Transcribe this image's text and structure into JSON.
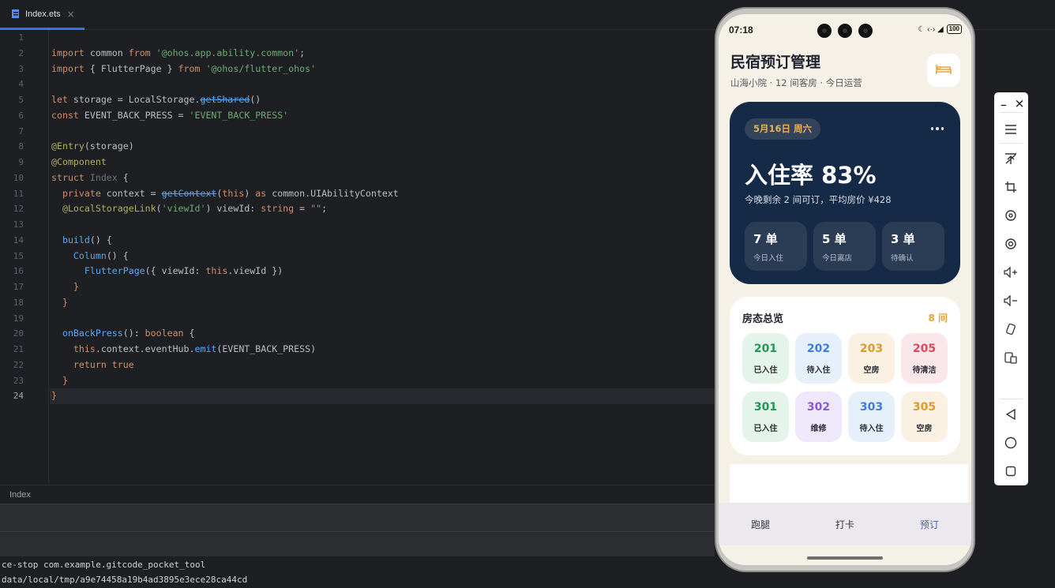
{
  "editor": {
    "tab_label": "Index.ets",
    "tab_close": "×",
    "line_numbers": [
      "1",
      "2",
      "3",
      "4",
      "5",
      "6",
      "7",
      "8",
      "9",
      "10",
      "11",
      "12",
      "13",
      "14",
      "15",
      "16",
      "17",
      "18",
      "19",
      "20",
      "21",
      "22",
      "23",
      "24"
    ],
    "code": {
      "l2_kw1": "import",
      "l2_mid": " common ",
      "l2_kw2": "from",
      "l2_str": " '@ohos.app.ability.common'",
      "l2_end": ";",
      "l3_kw1": "import",
      "l3_mid": " { FlutterPage } ",
      "l3_kw2": "from",
      "l3_str": " '@ohos/flutter_ohos'",
      "l5_kw": "let",
      "l5_mid": " storage = LocalStorage.",
      "l5_fn": "getShared",
      "l5_end": "()",
      "l6_kw": "const",
      "l6_mid": " EVENT_BACK_PRESS = ",
      "l6_str": "'EVENT_BACK_PRESS'",
      "l8_ann": "@Entry",
      "l8_end": "(storage)",
      "l9_ann": "@Component",
      "l10_kw": "struct",
      "l10_typ": " Index",
      "l10_end": " {",
      "l11_kw": "  private",
      "l11_mid": " context = ",
      "l11_fn": "getContext",
      "l11_p1": "(",
      "l11_this": "this",
      "l11_p2": ") ",
      "l11_as": "as",
      "l11_end": " common.UIAbilityContext",
      "l12_ann": "  @LocalStorageLink",
      "l12_p1": "(",
      "l12_str": "'viewId'",
      "l12_mid": ") viewId: ",
      "l12_typ": "string",
      "l12_eq": " = ",
      "l12_str2": "\"\"",
      "l12_end": ";",
      "l14_fn": "  build",
      "l14_end": "() {",
      "l15_fn": "    Column",
      "l15_end": "() {",
      "l16_fn": "      FlutterPage",
      "l16_mid": "({ viewId: ",
      "l16_this": "this",
      "l16_end": ".viewId })",
      "l17": "    }",
      "l18": "  }",
      "l20_fn": "  onBackPress",
      "l20_mid": "(): ",
      "l20_typ": "boolean",
      "l20_end": " {",
      "l21_this": "    this",
      "l21_mid": ".context.eventHub.",
      "l21_fn": "emit",
      "l21_end": "(EVENT_BACK_PRESS)",
      "l22_kw": "    return",
      "l22_kw2": " true",
      "l23": "  }",
      "l24": "}"
    },
    "breadcrumb": "Index",
    "console_lines": [
      "ce-stop com.example.gitcode_pocket_tool",
      "data/local/tmp/a9e74458a19b4ad3895e3ece28ca44cd"
    ]
  },
  "phone": {
    "status": {
      "time": "07:18",
      "right_icons": "☾ ‹·› ◢",
      "battery": "100"
    },
    "header": {
      "title": "民宿预订管理",
      "subtitle": "山海小院 · 12 间客房 · 今日运营",
      "icon": "bed-icon"
    },
    "hero": {
      "date": "5月16日 周六",
      "occupancy": "入住率 83%",
      "summary": "今晚剩余 2 间可订，平均房价 ¥428",
      "stats": [
        {
          "value": "7 单",
          "label": "今日入住"
        },
        {
          "value": "5 单",
          "label": "今日离店"
        },
        {
          "value": "3 单",
          "label": "待确认"
        }
      ]
    },
    "rooms": {
      "title": "房态总览",
      "count": "8 间",
      "items": [
        {
          "num": "201",
          "status": "已入住",
          "color": "#1f9a55",
          "bg": "#e5f4ea"
        },
        {
          "num": "202",
          "status": "待入住",
          "color": "#3b7de0",
          "bg": "#e6f0fb"
        },
        {
          "num": "203",
          "status": "空房",
          "color": "#e0992b",
          "bg": "#fbf1e2"
        },
        {
          "num": "205",
          "status": "待清洁",
          "color": "#e0485a",
          "bg": "#fbe7ea"
        },
        {
          "num": "301",
          "status": "已入住",
          "color": "#1f9a55",
          "bg": "#e5f4ea"
        },
        {
          "num": "302",
          "status": "维修",
          "color": "#8b5ad6",
          "bg": "#efe8fb"
        },
        {
          "num": "303",
          "status": "待入住",
          "color": "#3b7de0",
          "bg": "#e6f0fb"
        },
        {
          "num": "305",
          "status": "空房",
          "color": "#e0992b",
          "bg": "#fbf1e2"
        }
      ]
    },
    "nav": [
      {
        "label": "跑腿",
        "active": false
      },
      {
        "label": "打卡",
        "active": false
      },
      {
        "label": "预订",
        "active": true
      }
    ]
  },
  "toolbar": {
    "minimize": "–",
    "close": "×",
    "icons": [
      "menu-icon",
      "pin-top-icon",
      "crop-icon",
      "rotate-icon",
      "at-icon",
      "volume-up-icon",
      "volume-down-icon",
      "shake-icon",
      "screen-switch-icon",
      "back-icon",
      "home-icon",
      "recent-apps-icon"
    ]
  }
}
